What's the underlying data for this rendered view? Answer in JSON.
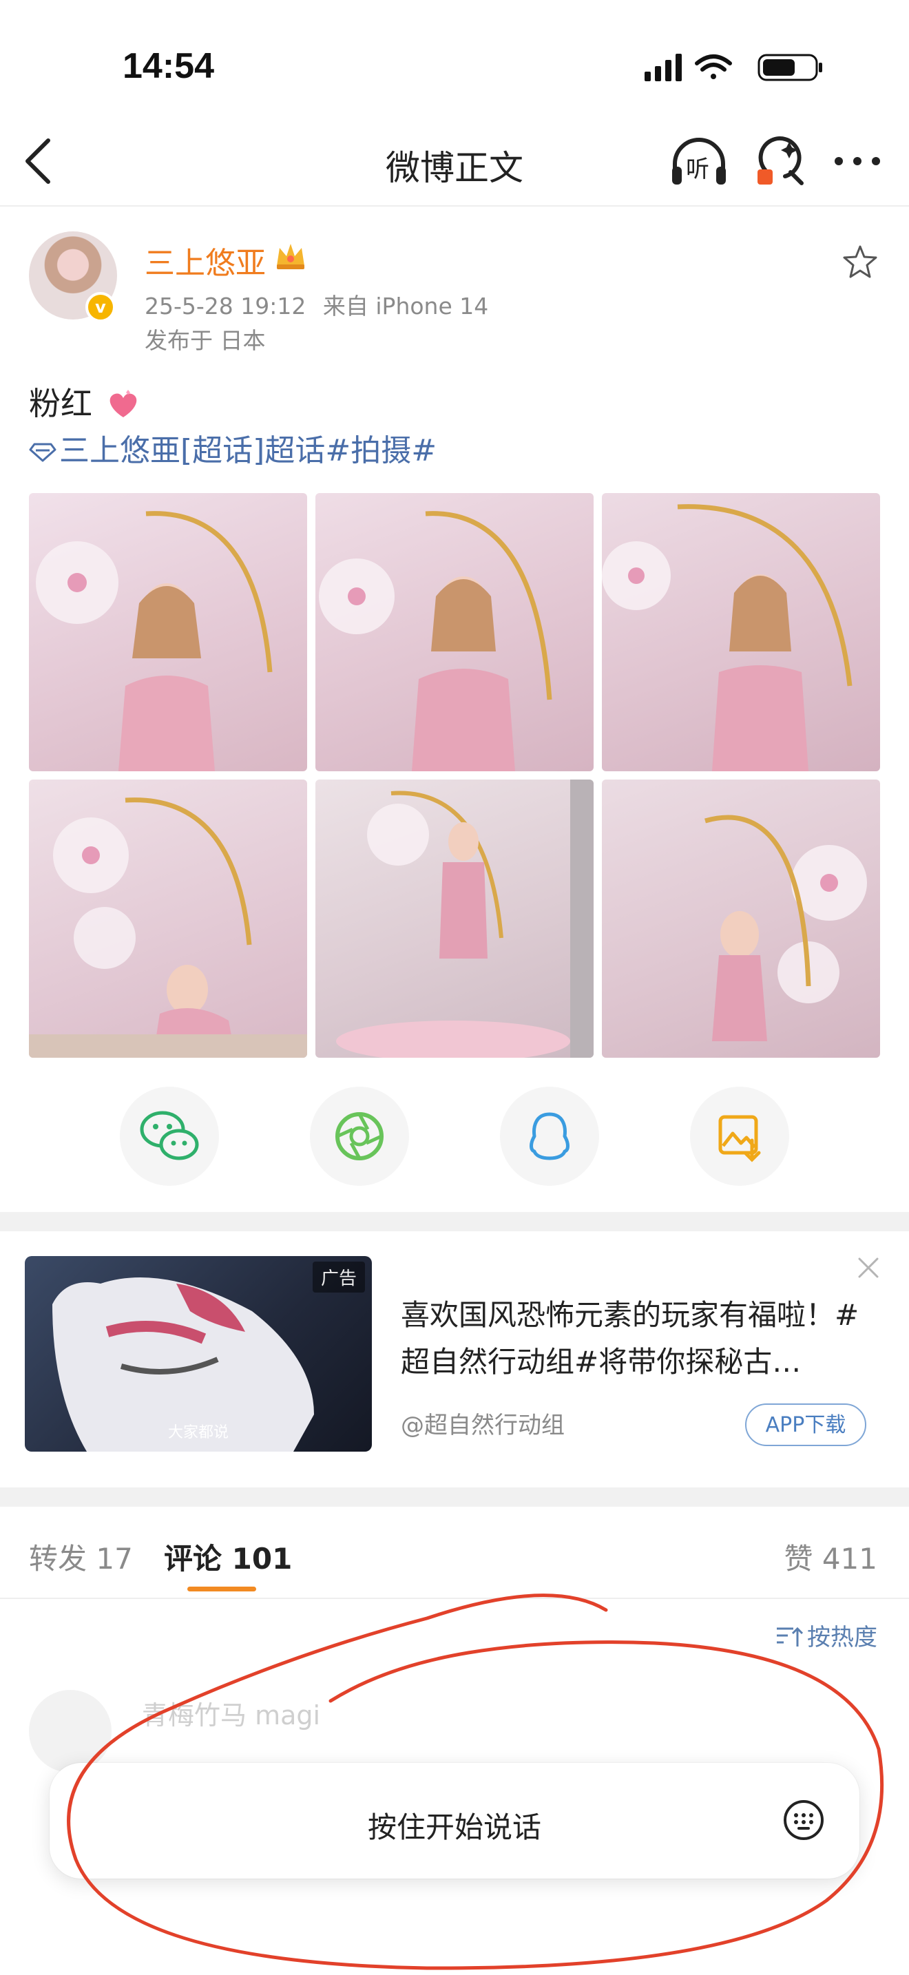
{
  "status_bar": {
    "time": "14:54"
  },
  "nav": {
    "title": "微博正文",
    "listen_label": "听"
  },
  "post": {
    "author": "三上悠亚",
    "timestamp": "25-5-28 19:12",
    "source": "来自 iPhone 14",
    "location": "发布于 日本",
    "text": "粉红",
    "topics": "三上悠亜[超话]超话#拍摄#"
  },
  "photos": [
    {
      "name": "photo-1",
      "bg": "#ead7e0"
    },
    {
      "name": "photo-2",
      "bg": "#e6cfd8"
    },
    {
      "name": "photo-3",
      "bg": "#e9d3de"
    },
    {
      "name": "photo-4",
      "bg": "#e8d6de"
    },
    {
      "name": "photo-5",
      "bg": "#e2d0d6"
    },
    {
      "name": "photo-6",
      "bg": "#e7d3dc"
    }
  ],
  "share": [
    {
      "name": "wechat-icon",
      "color": "#2fb06b"
    },
    {
      "name": "moments-icon",
      "color": "#68c45a"
    },
    {
      "name": "qq-icon",
      "color": "#3a9ce0"
    },
    {
      "name": "save-image-icon",
      "color": "#f0a818"
    }
  ],
  "ad": {
    "tag": "广告",
    "thumb_caption": "大家都说",
    "title": "喜欢国风恐怖元素的玩家有福啦！#超自然行动组#将带你探秘古…",
    "source": "@超自然行动组",
    "button": "APP下载"
  },
  "tabs": {
    "repost": "转发 17",
    "comments": "评论 101",
    "likes": "赞 411"
  },
  "sort_label": "按热度",
  "comment_preview_name": "青梅竹马 magi",
  "voice_input": {
    "label": "按住开始说话"
  },
  "colors": {
    "accent": "#f28a22",
    "link": "#4a6ea9",
    "annotation": "#e2412a"
  }
}
